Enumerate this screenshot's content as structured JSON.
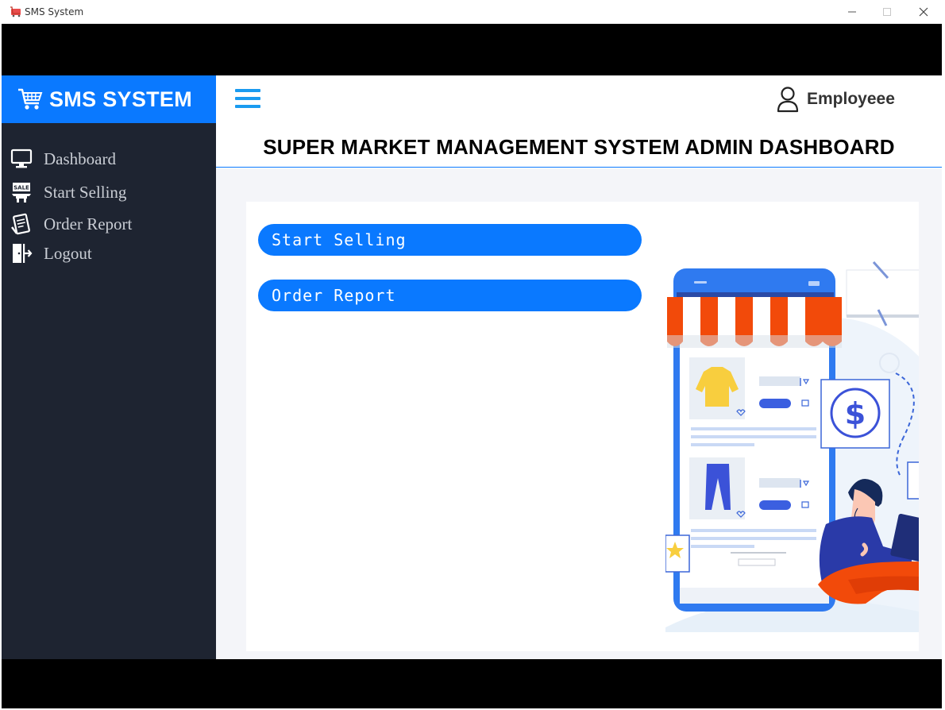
{
  "window": {
    "title": "SMS System",
    "icon": "cart-app-icon"
  },
  "brand": {
    "name": "SMS SYSTEM",
    "icon": "cart-icon",
    "color": "#0a79ff"
  },
  "sidebar": {
    "items": [
      {
        "label": "Dashboard",
        "icon": "monitor-icon"
      },
      {
        "label": "Start Selling",
        "icon": "sale-stand-icon"
      },
      {
        "label": "Order Report",
        "icon": "report-icon"
      },
      {
        "label": "Logout",
        "icon": "logout-door-icon"
      }
    ]
  },
  "header": {
    "menu_icon": "hamburger-icon",
    "user_icon": "user-icon",
    "user_name": "Employeee",
    "page_title": "SUPER MARKET MANAGEMENT SYSTEM ADMIN DASHBOARD"
  },
  "main": {
    "buttons": [
      {
        "label": "Start Selling"
      },
      {
        "label": "Order Report"
      }
    ],
    "illustration": "online-shop-illustration"
  },
  "colors": {
    "accent": "#0a79ff",
    "sidebar_bg": "#1e2431",
    "hamburger": "#1a9bf0",
    "awning": "#f24a0a"
  }
}
